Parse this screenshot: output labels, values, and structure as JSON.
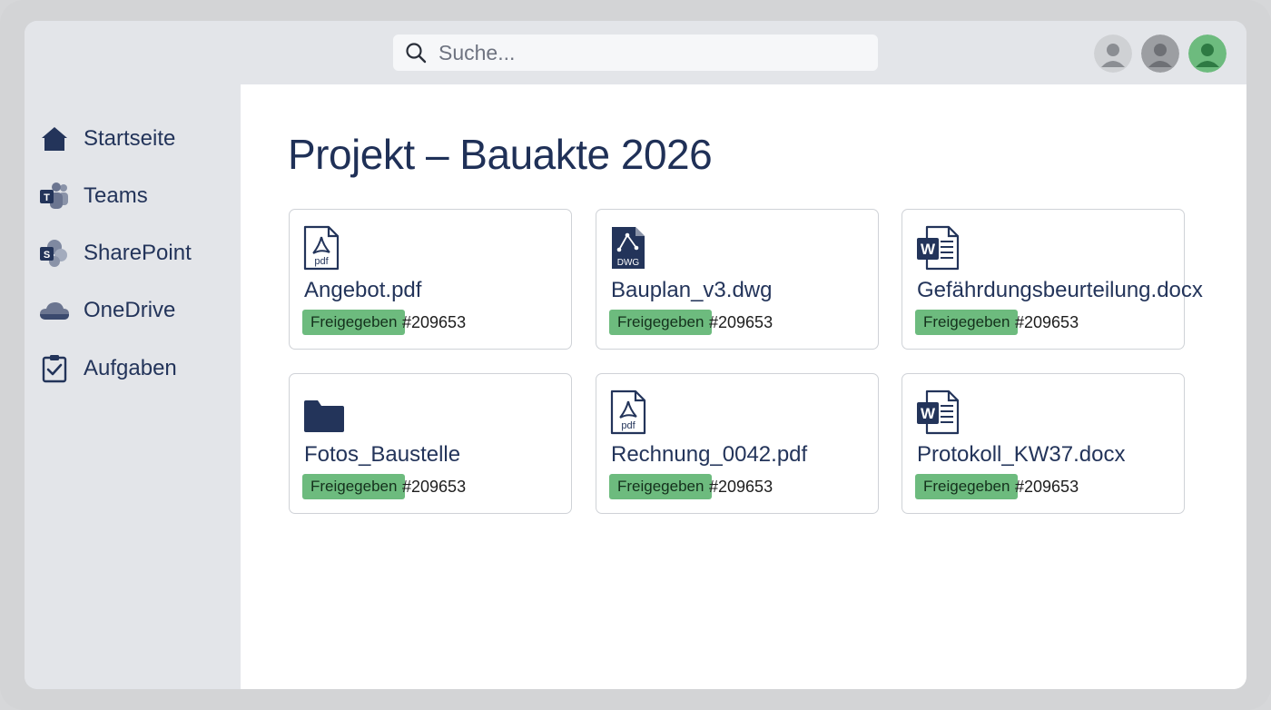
{
  "search": {
    "placeholder": "Suche..."
  },
  "sidebar": {
    "items": [
      {
        "label": "Startseite",
        "icon": "home-icon"
      },
      {
        "label": "Teams",
        "icon": "teams-icon"
      },
      {
        "label": "SharePoint",
        "icon": "sharepoint-icon"
      },
      {
        "label": "OneDrive",
        "icon": "onedrive-icon"
      },
      {
        "label": "Aufgaben",
        "icon": "tasks-icon"
      }
    ]
  },
  "main": {
    "title": "Projekt – Bauakte 2026",
    "files": [
      {
        "name": "Angebot.pdf",
        "icon": "pdf-file-icon",
        "status": "Freigegeben",
        "id": "#209653"
      },
      {
        "name": "Bauplan_v3.dwg",
        "icon": "dwg-file-icon",
        "status": "Freigegeben",
        "id": "#209653"
      },
      {
        "name": "Gefährdungsbeurteilung.docx",
        "icon": "word-file-icon",
        "status": "Freigegeben",
        "id": "#209653"
      },
      {
        "name": "Fotos_Baustelle",
        "icon": "folder-icon",
        "status": "Freigegeben",
        "id": "#209653"
      },
      {
        "name": "Rechnung_0042.pdf",
        "icon": "pdf-file-icon",
        "status": "Freigegeben",
        "id": "#209653"
      },
      {
        "name": "Protokoll_KW37.docx",
        "icon": "word-file-icon",
        "status": "Freigegeben",
        "id": "#209653"
      }
    ],
    "icon_labels": {
      "pdf": "pdf",
      "dwg": "DWG",
      "word": "W",
      "teams": "T",
      "sharepoint": "S"
    }
  },
  "colors": {
    "accent_navy": "#23345a",
    "badge_green": "#6dbb7e",
    "avatar_active": "#6dbb7e"
  }
}
